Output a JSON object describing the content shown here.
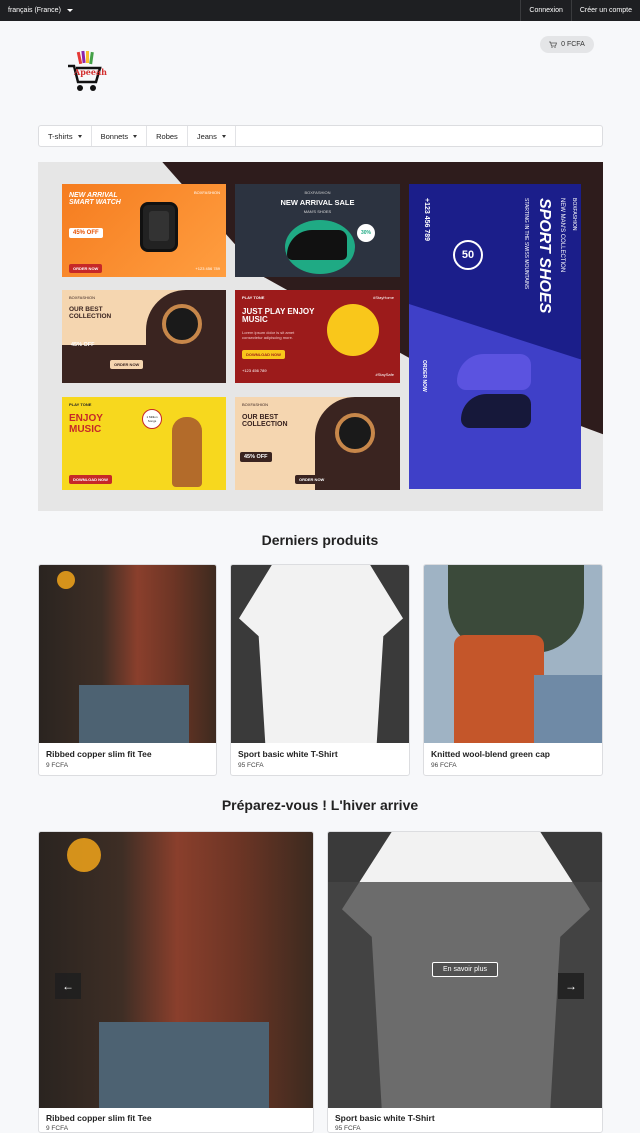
{
  "topbar": {
    "language": "français (France)",
    "login": "Connexion",
    "signup": "Créer un compte"
  },
  "header": {
    "logo_text": "Apeeah",
    "cart_total": "0 FCFA"
  },
  "categories": [
    {
      "label": "T-shirts",
      "dropdown": true
    },
    {
      "label": "Bonnets",
      "dropdown": true
    },
    {
      "label": "Robes",
      "dropdown": false
    },
    {
      "label": "Jeans",
      "dropdown": true
    }
  ],
  "banner": {
    "tile1": {
      "title": "NEW ARRIVAL SMART WATCH",
      "discount": "45% OFF",
      "cta": "ORDER NOW",
      "brand": "BOXFASHION",
      "phone": "+123 456 789"
    },
    "tile2": {
      "brand": "BOXFASHION",
      "title": "NEW ARRIVAL SALE",
      "subtitle": "MAN'S SHOES",
      "badge": "30%"
    },
    "tile3": {
      "brand": "BOXFASHION",
      "title": "OUR BEST COLLECTION",
      "discount": "45% OFF",
      "cta": "ORDER NOW"
    },
    "tile4": {
      "brand": "PLAY TONE",
      "tag": "#StayHome",
      "title": "JUST PLAY ENJOY MUSIC",
      "body": "Lorem ipsum dolor is sit amet consectetur adipiscing more.",
      "cta": "DOWNLOAD NOW",
      "phone": "+123 456 789",
      "tag2": "#StaySafe"
    },
    "tile5": {
      "brand": "PLAY TONE",
      "title": "ENJOY MUSIC",
      "badge": "1 Million Songs",
      "cta": "DOWNLOAD NOW"
    },
    "tile6": {
      "brand": "BOXFASHION",
      "title": "OUR BEST COLLECTION",
      "discount": "45% OFF",
      "cta": "ORDER NOW"
    },
    "tile7": {
      "brand": "BOXFASHION",
      "kicker": "NEW MAN'S COLLECTION",
      "title": "SPORT SHOES",
      "subtitle": "STARTING IN THE SWISS MOUNTAINS",
      "phone": "+123 456 789",
      "discount": "50",
      "cta": "ORDER NOW"
    }
  },
  "latest": {
    "title": "Derniers produits",
    "products": [
      {
        "name": "Ribbed copper slim fit Tee",
        "price": "9 FCFA"
      },
      {
        "name": "Sport basic white T-Shirt",
        "price": "95 FCFA"
      },
      {
        "name": "Knitted wool-blend green cap",
        "price": "96 FCFA"
      }
    ]
  },
  "winter": {
    "title": "Préparez-vous ! L'hiver arrive",
    "products": [
      {
        "name": "Ribbed copper slim fit Tee",
        "price": "9 FCFA"
      },
      {
        "name": "Sport basic white T-Shirt",
        "price": "95 FCFA"
      }
    ],
    "learn_more": "En savoir plus",
    "prev_icon": "arrow-left-icon",
    "next_icon": "arrow-right-icon"
  }
}
